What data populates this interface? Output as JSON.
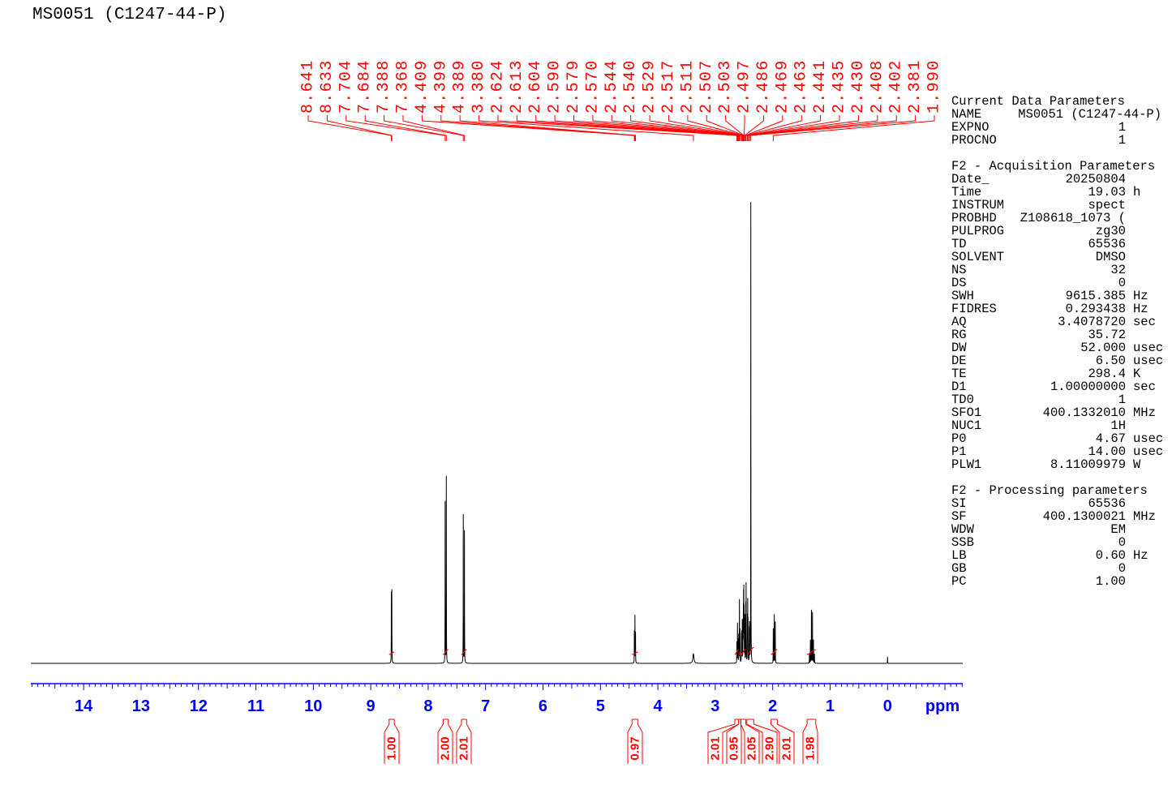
{
  "colors": {
    "spectrum": "#000000",
    "labels": "#ff0000",
    "axis": "#0000ff",
    "text": "#000000"
  },
  "chart_data": {
    "type": "line",
    "title": "MS0051 (C1247-44-P)",
    "xlabel": "ppm",
    "xlim": [
      14.92,
      -1.31
    ],
    "x_ticks": [
      "14",
      "13",
      "12",
      "11",
      "10",
      "9",
      "8",
      "7",
      "6",
      "5",
      "4",
      "3",
      "2",
      "1",
      "0"
    ],
    "peak_list": [
      "8.641",
      "8.633",
      "7.704",
      "7.684",
      "7.388",
      "7.368",
      "4.409",
      "4.399",
      "4.389",
      "3.380",
      "2.624",
      "2.613",
      "2.604",
      "2.590",
      "2.579",
      "2.570",
      "2.544",
      "2.540",
      "2.529",
      "2.517",
      "2.511",
      "2.507",
      "2.503",
      "2.497",
      "2.486",
      "2.469",
      "2.463",
      "2.441",
      "2.435",
      "2.430",
      "2.408",
      "2.402",
      "2.381",
      "1.990"
    ],
    "spectrum": [
      {
        "ppm": 8.641,
        "intensity": 0.15
      },
      {
        "ppm": 8.633,
        "intensity": 0.155
      },
      {
        "ppm": 7.704,
        "intensity": 0.35
      },
      {
        "ppm": 7.684,
        "intensity": 0.405
      },
      {
        "ppm": 7.388,
        "intensity": 0.322
      },
      {
        "ppm": 7.368,
        "intensity": 0.287
      },
      {
        "ppm": 4.409,
        "intensity": 0.068
      },
      {
        "ppm": 4.399,
        "intensity": 0.102
      },
      {
        "ppm": 4.389,
        "intensity": 0.066
      },
      {
        "ppm": 3.38,
        "intensity": 0.021
      },
      {
        "ppm": 2.624,
        "intensity": 0.045
      },
      {
        "ppm": 2.613,
        "intensity": 0.085
      },
      {
        "ppm": 2.604,
        "intensity": 0.05
      },
      {
        "ppm": 2.59,
        "intensity": 0.06
      },
      {
        "ppm": 2.579,
        "intensity": 0.135
      },
      {
        "ppm": 2.57,
        "intensity": 0.07
      },
      {
        "ppm": 2.544,
        "intensity": 0.055
      },
      {
        "ppm": 2.54,
        "intensity": 0.06
      },
      {
        "ppm": 2.529,
        "intensity": 0.09
      },
      {
        "ppm": 2.517,
        "intensity": 0.08
      },
      {
        "ppm": 2.511,
        "intensity": 0.1
      },
      {
        "ppm": 2.507,
        "intensity": 0.12
      },
      {
        "ppm": 2.503,
        "intensity": 0.14
      },
      {
        "ppm": 2.497,
        "intensity": 0.11
      },
      {
        "ppm": 2.486,
        "intensity": 0.1
      },
      {
        "ppm": 2.469,
        "intensity": 0.12
      },
      {
        "ppm": 2.463,
        "intensity": 0.165
      },
      {
        "ppm": 2.441,
        "intensity": 0.095
      },
      {
        "ppm": 2.435,
        "intensity": 0.125
      },
      {
        "ppm": 2.43,
        "intensity": 0.085
      },
      {
        "ppm": 2.408,
        "intensity": 0.07
      },
      {
        "ppm": 2.402,
        "intensity": 0.08
      },
      {
        "ppm": 2.381,
        "intensity": 1.0
      },
      {
        "ppm": 1.99,
        "intensity": 0.075
      },
      {
        "ppm": 1.972,
        "intensity": 0.105
      },
      {
        "ppm": 1.955,
        "intensity": 0.09
      },
      {
        "ppm": 1.36,
        "intensity": 0.02
      },
      {
        "ppm": 1.343,
        "intensity": 0.05
      },
      {
        "ppm": 1.325,
        "intensity": 0.115
      },
      {
        "ppm": 1.307,
        "intensity": 0.11
      },
      {
        "ppm": 1.29,
        "intensity": 0.05
      },
      {
        "ppm": 1.273,
        "intensity": 0.02
      },
      {
        "ppm": 0.0,
        "intensity": 0.014
      }
    ],
    "integrals": [
      {
        "label": "1.00",
        "from": 8.68,
        "to": 8.59
      },
      {
        "label": "2.00",
        "from": 7.74,
        "to": 7.65
      },
      {
        "label": "2.01",
        "from": 7.42,
        "to": 7.33
      },
      {
        "label": "0.97",
        "from": 4.45,
        "to": 4.35
      },
      {
        "label": "2.01",
        "from": 2.66,
        "to": 2.595
      },
      {
        "label": "0.95",
        "from": 2.595,
        "to": 2.555
      },
      {
        "label": "2.05",
        "from": 2.555,
        "to": 2.47
      },
      {
        "label": "2.90",
        "from": 2.45,
        "to": 2.33
      },
      {
        "label": "2.01",
        "from": 2.03,
        "to": 1.92
      },
      {
        "label": "1.98",
        "from": 1.4,
        "to": 1.25
      }
    ]
  },
  "parameters": {
    "current": {
      "heading": "Current Data Parameters",
      "rows": [
        {
          "name": "NAME",
          "value": "MS0051 (C1247-44-P)"
        },
        {
          "name": "EXPNO",
          "value": "1"
        },
        {
          "name": "PROCNO",
          "value": "1"
        }
      ]
    },
    "acquisition": {
      "heading": "F2 - Acquisition Parameters",
      "rows": [
        {
          "name": "Date_",
          "value": "20250804"
        },
        {
          "name": "Time",
          "value": "19.03",
          "unit": "h"
        },
        {
          "name": "INSTRUM",
          "value": "spect"
        },
        {
          "name": "PROBHD",
          "value": "Z108618_1073 ("
        },
        {
          "name": "PULPROG",
          "value": "zg30"
        },
        {
          "name": "TD",
          "value": "65536"
        },
        {
          "name": "SOLVENT",
          "value": "DMSO"
        },
        {
          "name": "NS",
          "value": "32"
        },
        {
          "name": "DS",
          "value": "0"
        },
        {
          "name": "SWH",
          "value": "9615.385",
          "unit": "Hz"
        },
        {
          "name": "FIDRES",
          "value": "0.293438",
          "unit": "Hz"
        },
        {
          "name": "AQ",
          "value": "3.4078720",
          "unit": "sec"
        },
        {
          "name": "RG",
          "value": "35.72"
        },
        {
          "name": "DW",
          "value": "52.000",
          "unit": "usec"
        },
        {
          "name": "DE",
          "value": "6.50",
          "unit": "usec"
        },
        {
          "name": "TE",
          "value": "298.4",
          "unit": "K"
        },
        {
          "name": "D1",
          "value": "1.00000000",
          "unit": "sec"
        },
        {
          "name": "TD0",
          "value": "1"
        },
        {
          "name": "SFO1",
          "value": "400.1332010",
          "unit": "MHz"
        },
        {
          "name": "NUC1",
          "value": "1H"
        },
        {
          "name": "P0",
          "value": "4.67",
          "unit": "usec"
        },
        {
          "name": "P1",
          "value": "14.00",
          "unit": "usec"
        },
        {
          "name": "PLW1",
          "value": "8.11009979",
          "unit": "W"
        }
      ]
    },
    "processing": {
      "heading": "F2 - Processing parameters",
      "rows": [
        {
          "name": "SI",
          "value": "65536"
        },
        {
          "name": "SF",
          "value": "400.1300021",
          "unit": "MHz"
        },
        {
          "name": "WDW",
          "value": "EM"
        },
        {
          "name": "SSB",
          "value": "0"
        },
        {
          "name": "LB",
          "value": "0.60",
          "unit": "Hz"
        },
        {
          "name": "GB",
          "value": "0"
        },
        {
          "name": "PC",
          "value": "1.00"
        }
      ]
    }
  }
}
